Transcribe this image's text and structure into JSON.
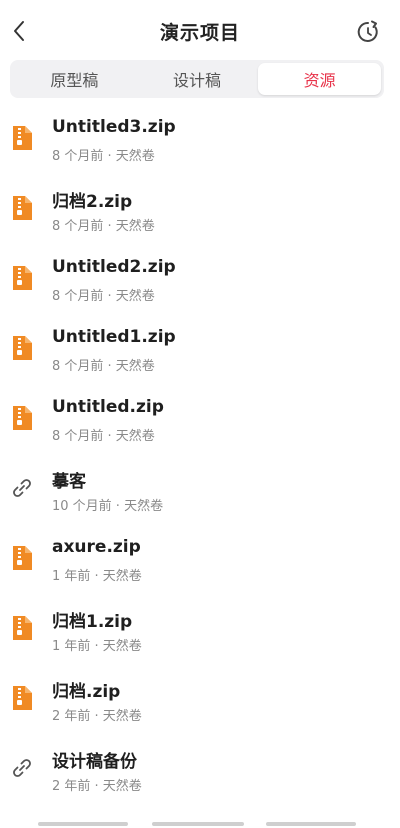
{
  "header": {
    "title": "演示项目",
    "back_icon": "chevron-left-icon",
    "refresh_icon": "refresh-icon"
  },
  "tabs": [
    {
      "label": "原型稿",
      "active": false
    },
    {
      "label": "设计稿",
      "active": false
    },
    {
      "label": "资源",
      "active": true
    }
  ],
  "colors": {
    "accent": "#e8334a",
    "zip_icon": "#f08a24"
  },
  "files": [
    {
      "name": "Untitled3.zip",
      "meta": "8 个月前 · 天然卷",
      "icon": "zip-file-icon"
    },
    {
      "name": "归档2.zip",
      "meta": "8 个月前 · 天然卷",
      "icon": "zip-file-icon"
    },
    {
      "name": "Untitled2.zip",
      "meta": "8 个月前 · 天然卷",
      "icon": "zip-file-icon"
    },
    {
      "name": "Untitled1.zip",
      "meta": "8 个月前 · 天然卷",
      "icon": "zip-file-icon"
    },
    {
      "name": "Untitled.zip",
      "meta": "8 个月前 · 天然卷",
      "icon": "zip-file-icon"
    },
    {
      "name": "摹客",
      "meta": "10 个月前 · 天然卷",
      "icon": "link-icon"
    },
    {
      "name": "axure.zip",
      "meta": "1 年前 · 天然卷",
      "icon": "zip-file-icon"
    },
    {
      "name": "归档1.zip",
      "meta": "1 年前 · 天然卷",
      "icon": "zip-file-icon"
    },
    {
      "name": "归档.zip",
      "meta": "2 年前 · 天然卷",
      "icon": "zip-file-icon"
    },
    {
      "name": "设计稿备份",
      "meta": "2 年前 · 天然卷",
      "icon": "link-icon"
    }
  ]
}
